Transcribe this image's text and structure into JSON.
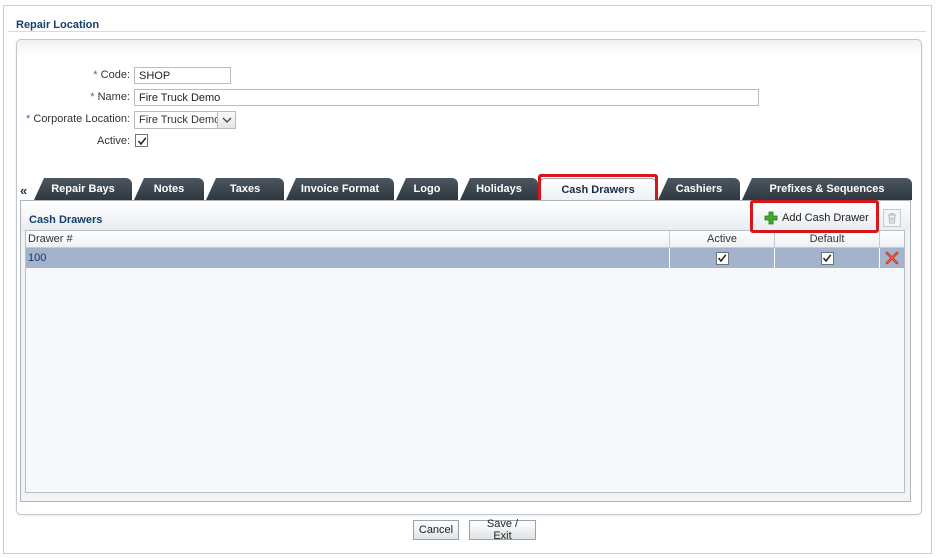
{
  "page": {
    "title": "Repair Location"
  },
  "form": {
    "code": {
      "label": "Code:",
      "value": "SHOP"
    },
    "name": {
      "label": "Name:",
      "value": "Fire Truck Demo"
    },
    "corporate_location": {
      "label": "Corporate Location:",
      "value": "Fire Truck Demo"
    },
    "active": {
      "label": "Active:",
      "checked": true
    },
    "required_marker": "*"
  },
  "tabs": {
    "scroll_left": "«",
    "items": [
      {
        "label": "Repair Bays"
      },
      {
        "label": "Notes"
      },
      {
        "label": "Taxes"
      },
      {
        "label": "Invoice Format"
      },
      {
        "label": "Logo"
      },
      {
        "label": "Holidays"
      },
      {
        "label": "Cash Drawers",
        "active": true
      },
      {
        "label": "Cashiers"
      },
      {
        "label": "Prefixes & Sequences"
      }
    ]
  },
  "cash_drawers": {
    "title": "Cash Drawers",
    "add_label": "Add Cash Drawer",
    "columns": [
      "Drawer #",
      "Active",
      "Default"
    ],
    "rows": [
      {
        "drawer": "100",
        "active": true,
        "default": true
      }
    ]
  },
  "footer": {
    "cancel_label": "Cancel",
    "save_label": "Save / Exit"
  },
  "colors": {
    "highlight": "#d7161c",
    "tab_dark": "#3a444d",
    "title_blue": "#14406b",
    "row_selected": "#a4b3cc"
  }
}
